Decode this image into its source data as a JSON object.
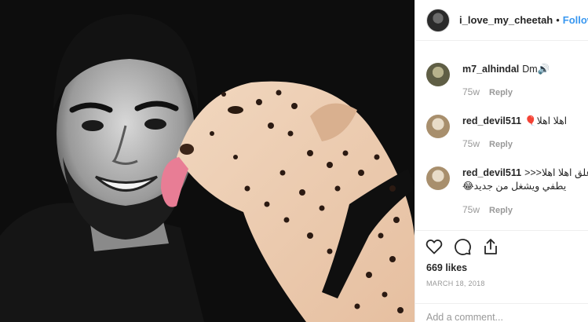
{
  "post": {
    "username": "i_love_my_cheetah",
    "separator": "•",
    "follow_label": "Follow",
    "photo_alt_icon": "photo-man-with-cheetah"
  },
  "comments": [
    {
      "username": "m7_alhindal",
      "text": "Dm🔊",
      "age": "75w",
      "reply_label": "Reply",
      "avatar_color": "#7b7a5c"
    },
    {
      "username": "red_devil511",
      "text": "اهلا اهلا🎈",
      "age": "75w",
      "reply_label": "Reply",
      "avatar_color": "#c9b59a"
    },
    {
      "username": "red_devil511",
      "text": "علق اهلا اهلا<<< يطفي ويشغل من جديد😂",
      "age": "75w",
      "reply_label": "Reply",
      "avatar_color": "#c9b59a"
    }
  ],
  "actions": {
    "icons": [
      "heart-icon",
      "comment-icon",
      "share-icon"
    ],
    "likes": "669 likes",
    "date": "MARCH 18, 2018"
  },
  "add_comment": {
    "placeholder": "Add a comment..."
  },
  "colors": {
    "link": "#3897f0",
    "muted": "#999999",
    "text": "#262626",
    "border": "#efefef"
  }
}
